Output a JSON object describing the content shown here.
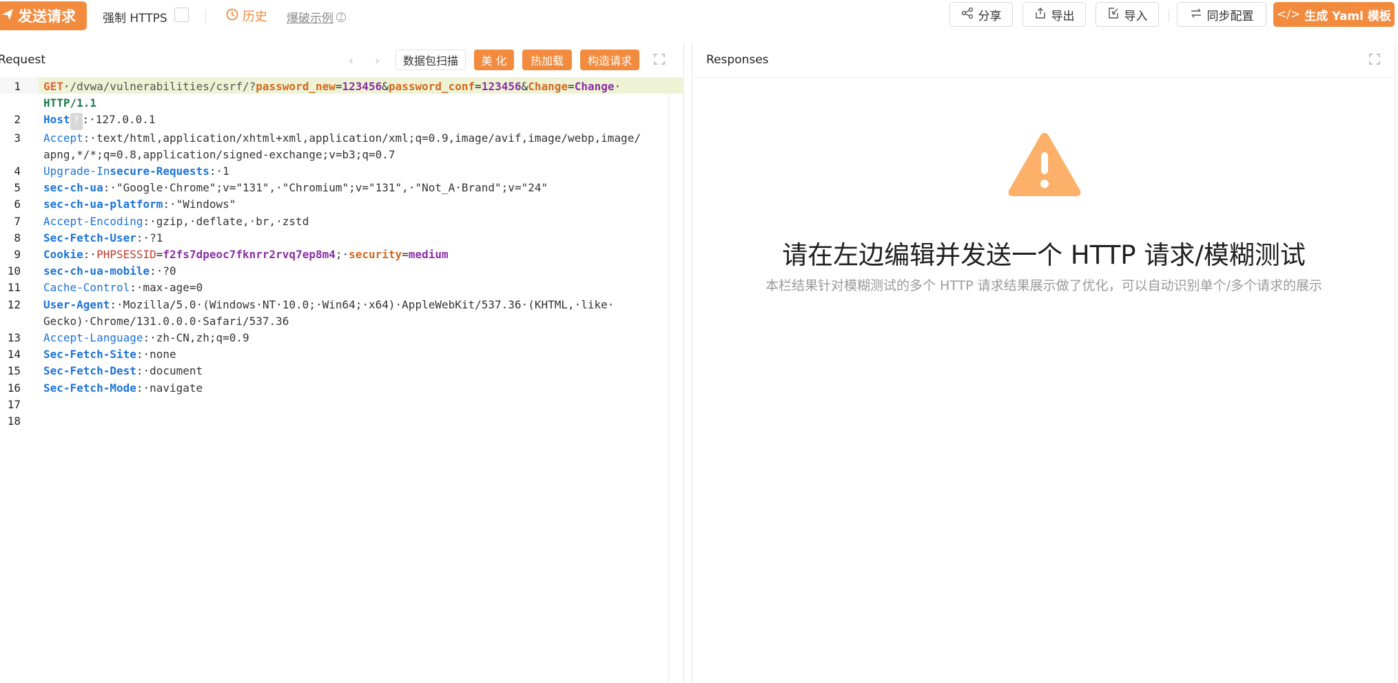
{
  "toolbar": {
    "send_label": "发送请求",
    "force_https_label": "强制 HTTPS",
    "history_label": "历史",
    "fuzz_example_label": "爆破示例",
    "share_label": "分享",
    "export_label": "导出",
    "import_label": "导入",
    "sync_label": "同步配置",
    "yaml_label": "生成 Yaml 模板",
    "accent_color": "#f28b3e"
  },
  "request": {
    "title": "Request",
    "packet_scan_label": "数据包扫描",
    "beautify_label": "美 化",
    "hot_reload_label": "热加载",
    "build_request_label": "构造请求",
    "lines": [
      {
        "n": "1",
        "spans": [
          {
            "c": "k-method",
            "t": "GET"
          },
          {
            "c": "",
            "t": "·"
          },
          {
            "c": "k-path",
            "t": "/dvwa/vulnerabilities/csrf/?"
          },
          {
            "c": "k-pname",
            "t": "password_new"
          },
          {
            "c": "",
            "t": "="
          },
          {
            "c": "k-pval",
            "t": "123456"
          },
          {
            "c": "k-amp",
            "t": "&"
          },
          {
            "c": "k-pname",
            "t": "password_conf"
          },
          {
            "c": "",
            "t": "="
          },
          {
            "c": "k-pval",
            "t": "123456"
          },
          {
            "c": "k-amp",
            "t": "&"
          },
          {
            "c": "k-pname",
            "t": "Change"
          },
          {
            "c": "",
            "t": "="
          },
          {
            "c": "k-pval",
            "t": "Change"
          },
          {
            "c": "",
            "t": "·"
          }
        ]
      },
      {
        "n": "",
        "spans": [
          {
            "c": "k-ver",
            "t": "HTTP/1.1"
          }
        ]
      },
      {
        "n": "2",
        "spans": [
          {
            "c": "k-hdr",
            "t": "Host"
          },
          {
            "c": "qbox",
            "t": "?"
          },
          {
            "c": "",
            "t": ":·127.0.0.1"
          }
        ]
      },
      {
        "n": "3",
        "spans": [
          {
            "c": "k-hdr2",
            "t": "Accept"
          },
          {
            "c": "",
            "t": ":·text/html,application/xhtml+xml,application/xml;q=0.9,image/avif,image/webp,image/"
          }
        ]
      },
      {
        "n": "",
        "spans": [
          {
            "c": "",
            "t": "apng,*/*;q=0.8,application/signed-exchange;v=b3;q=0.7"
          }
        ]
      },
      {
        "n": "4",
        "spans": [
          {
            "c": "k-hdr2",
            "t": "Upgrade-In"
          },
          {
            "c": "k-hdr",
            "t": "secure-Requests"
          },
          {
            "c": "",
            "t": ":·1"
          }
        ]
      },
      {
        "n": "5",
        "spans": [
          {
            "c": "k-hdr",
            "t": "sec-ch-ua"
          },
          {
            "c": "",
            "t": ":·\"Google·Chrome\";v=\"131\",·\"Chromium\";v=\"131\",·\"Not_A·Brand\";v=\"24\""
          }
        ]
      },
      {
        "n": "6",
        "spans": [
          {
            "c": "k-hdr",
            "t": "sec-ch-ua-platform"
          },
          {
            "c": "",
            "t": ":·\"Windows\""
          }
        ]
      },
      {
        "n": "7",
        "spans": [
          {
            "c": "k-hdr2",
            "t": "Accept-Encoding"
          },
          {
            "c": "",
            "t": ":·gzip,·deflate,·br,·zstd"
          }
        ]
      },
      {
        "n": "8",
        "spans": [
          {
            "c": "k-hdr",
            "t": "Sec-Fetch-User"
          },
          {
            "c": "",
            "t": ":·?1"
          }
        ]
      },
      {
        "n": "9",
        "spans": [
          {
            "c": "k-hdr",
            "t": "Cookie"
          },
          {
            "c": "",
            "t": ":·"
          },
          {
            "c": "k-ck",
            "t": "PHPSESSID"
          },
          {
            "c": "",
            "t": "="
          },
          {
            "c": "k-ckv",
            "t": "f2fs7dpeoc7fknrr2rvq7ep8m4"
          },
          {
            "c": "",
            "t": ";·"
          },
          {
            "c": "k-ck2",
            "t": "security"
          },
          {
            "c": "",
            "t": "="
          },
          {
            "c": "k-ckv",
            "t": "medium"
          }
        ]
      },
      {
        "n": "10",
        "spans": [
          {
            "c": "k-hdr",
            "t": "sec-ch-ua-mobile"
          },
          {
            "c": "",
            "t": ":·?0"
          }
        ]
      },
      {
        "n": "11",
        "spans": [
          {
            "c": "k-hdr2",
            "t": "Cache-Control"
          },
          {
            "c": "",
            "t": ":·max-age=0"
          }
        ]
      },
      {
        "n": "12",
        "spans": [
          {
            "c": "k-hdr",
            "t": "User-Agent"
          },
          {
            "c": "",
            "t": ":·Mozilla/5.0·(Windows·NT·10.0;·Win64;·x64)·AppleWebKit/537.36·(KHTML,·like·"
          }
        ]
      },
      {
        "n": "",
        "spans": [
          {
            "c": "",
            "t": "Gecko)·Chrome/131.0.0.0·Safari/537.36"
          }
        ]
      },
      {
        "n": "13",
        "spans": [
          {
            "c": "k-hdr2",
            "t": "Accept-Language"
          },
          {
            "c": "",
            "t": ":·zh-CN,zh;q=0.9"
          }
        ]
      },
      {
        "n": "14",
        "spans": [
          {
            "c": "k-hdr",
            "t": "Sec-Fetch-Site"
          },
          {
            "c": "",
            "t": ":·none"
          }
        ]
      },
      {
        "n": "15",
        "spans": [
          {
            "c": "k-hdr",
            "t": "Sec-Fetch-Dest"
          },
          {
            "c": "",
            "t": ":·document"
          }
        ]
      },
      {
        "n": "16",
        "spans": [
          {
            "c": "k-hdr",
            "t": "Sec-Fetch-Mode"
          },
          {
            "c": "",
            "t": ":·navigate"
          }
        ]
      },
      {
        "n": "17",
        "spans": []
      },
      {
        "n": "18",
        "spans": []
      }
    ]
  },
  "responses": {
    "title": "Responses",
    "empty_title": "请在左边编辑并发送一个 HTTP 请求/模糊测试",
    "empty_desc": "本栏结果针对模糊测试的多个 HTTP 请求结果展示做了优化，可以自动识别单个/多个请求的展示",
    "warning_color": "#fdb069"
  }
}
